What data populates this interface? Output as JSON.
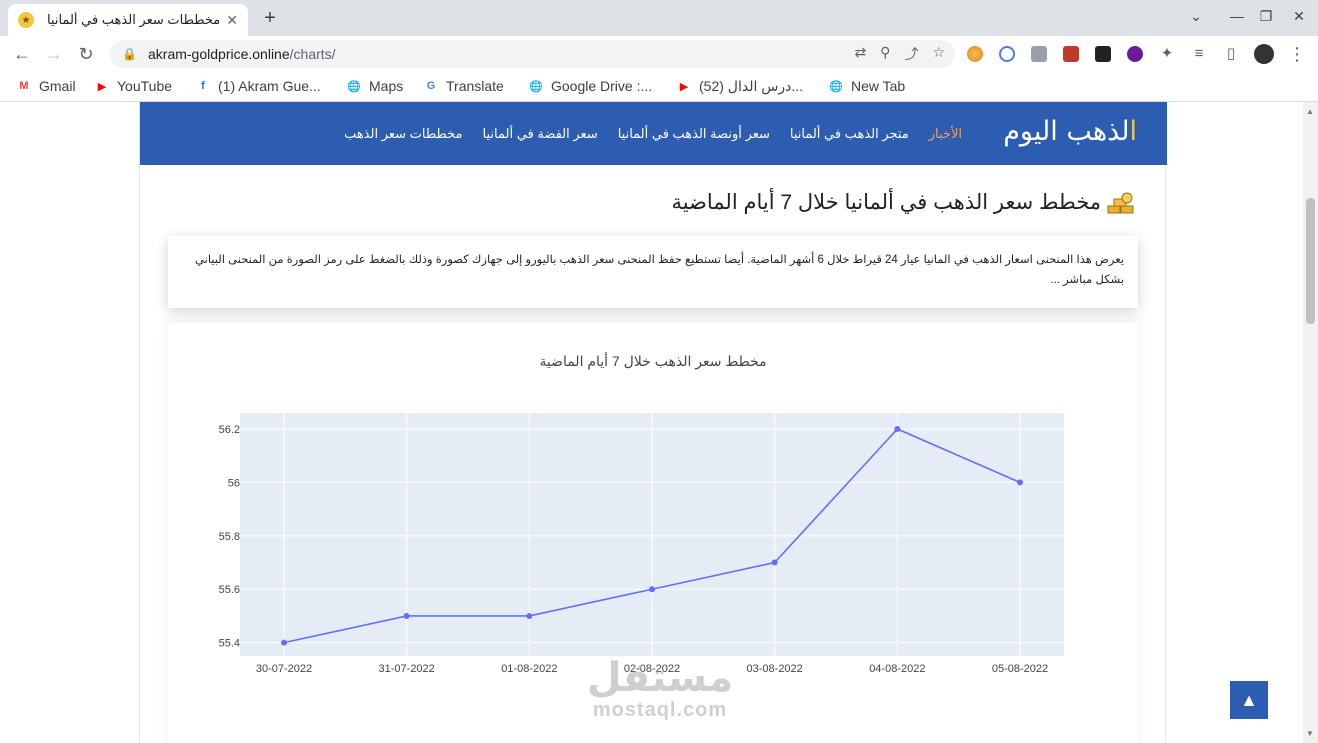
{
  "browser": {
    "tab_title": "مخططات سعر الذهب في ألمانيا",
    "tab_close": "✕",
    "new_tab": "+",
    "window_controls": [
      "⌄",
      "—",
      "❐",
      "✕"
    ],
    "url_host": "akram-goldprice.online",
    "url_path": "/charts/"
  },
  "bookmarks": [
    {
      "label": "Gmail",
      "icon": "gmail-icon",
      "color": "#ea4335",
      "glyph": "M"
    },
    {
      "label": "YouTube",
      "icon": "youtube-icon",
      "color": "#ff0000",
      "glyph": "▶"
    },
    {
      "label": "(1) Akram Gue...",
      "icon": "facebook-icon",
      "color": "#1877f2",
      "glyph": "f"
    },
    {
      "label": "Maps",
      "icon": "globe-icon",
      "color": "#5f6368",
      "glyph": "🌐"
    },
    {
      "label": "Translate",
      "icon": "translate-icon",
      "color": "#4285f4",
      "glyph": "G"
    },
    {
      "label": "Google Drive :...",
      "icon": "globe-icon",
      "color": "#5f6368",
      "glyph": "🌐"
    },
    {
      "label": "(52) درس الدال...",
      "icon": "youtube-icon",
      "color": "#ff0000",
      "glyph": "▶"
    },
    {
      "label": "New Tab",
      "icon": "globe-icon",
      "color": "#5f6368",
      "glyph": "🌐"
    }
  ],
  "site": {
    "brand": "الذهب اليوم",
    "brand_first": "ا",
    "brand_rest": "لذهب اليوم",
    "menu": [
      "الأخبار",
      "متجر الذهب في ألمانيا",
      "سعر أونصة الذهب في ألمانيا",
      "سعر الفضة في ألمانيا",
      "مخططات سعر الذهب"
    ],
    "heading": "مخطط سعر الذهب في ألمانيا خلال 7 أيام الماضية",
    "description": "يعرض هذا المنحنى اسعار الذهب في المانيا عيار 24 قيراط خلال 6 أشهر الماضية. أيضا تستطيع حفظ المنحنى سعر الذهب باليورو إلى جهازك كصورة وذلك بالضغط على رمز الصورة من المنحنى البياني بشكل مباشر ...",
    "back_to_top": "▲",
    "watermark_ar": "مستقل",
    "watermark_en": "mostaql.com"
  },
  "chart_data": {
    "type": "line",
    "title": "مخطط سعر الذهب خلال 7 أيام الماضية",
    "categories": [
      "30-07-2022",
      "31-07-2022",
      "01-08-2022",
      "02-08-2022",
      "03-08-2022",
      "04-08-2022",
      "05-08-2022"
    ],
    "values": [
      55.4,
      55.5,
      55.5,
      55.6,
      55.7,
      56.2,
      56.0
    ],
    "yticks": [
      55.4,
      55.6,
      55.8,
      56,
      56.2
    ],
    "ylim": [
      55.35,
      56.26
    ],
    "grid": true,
    "line_color": "#636efa",
    "plot_bg": "#e5ecf6"
  }
}
